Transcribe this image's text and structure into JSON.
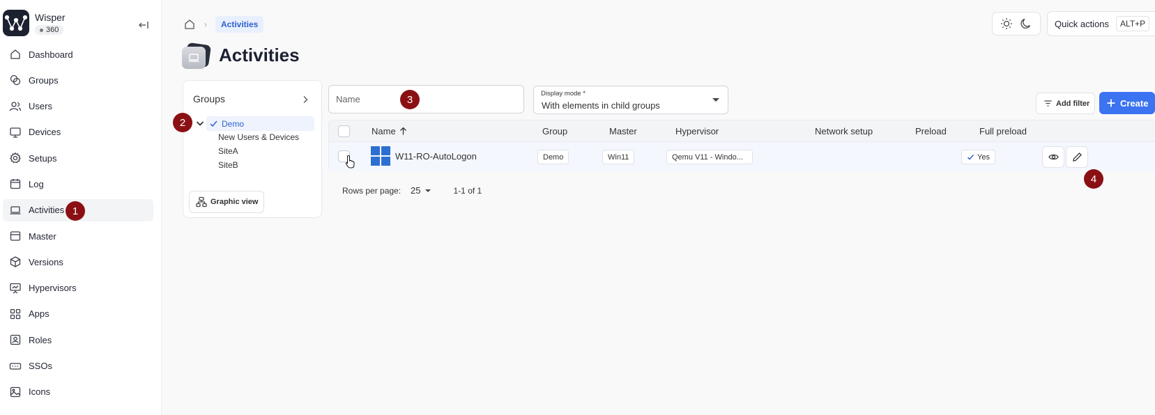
{
  "app": {
    "name": "Wisper",
    "badge": "360"
  },
  "sidebar": {
    "items": [
      {
        "label": "Dashboard",
        "icon": "home-icon"
      },
      {
        "label": "Groups",
        "icon": "groups-icon"
      },
      {
        "label": "Users",
        "icon": "users-icon"
      },
      {
        "label": "Devices",
        "icon": "monitor-icon"
      },
      {
        "label": "Setups",
        "icon": "gear-icon"
      },
      {
        "label": "Log",
        "icon": "calendar-icon"
      },
      {
        "label": "Activities",
        "icon": "laptop-icon",
        "active": true
      },
      {
        "label": "Master",
        "icon": "window-icon"
      },
      {
        "label": "Versions",
        "icon": "box-icon"
      },
      {
        "label": "Hypervisors",
        "icon": "presentation-icon"
      },
      {
        "label": "Apps",
        "icon": "grid-icon"
      },
      {
        "label": "Roles",
        "icon": "id-card-icon"
      },
      {
        "label": "SSOs",
        "icon": "key-icon"
      },
      {
        "label": "Icons",
        "icon": "image-icon"
      }
    ]
  },
  "header": {
    "breadcrumb_current": "Activities",
    "quick_actions_label": "Quick actions",
    "quick_actions_shortcut": "ALT+P",
    "page_title": "Activities"
  },
  "markers": [
    "1",
    "2",
    "3",
    "4"
  ],
  "groups_panel": {
    "title": "Groups",
    "selected": "Demo",
    "children": [
      "New Users & Devices",
      "SiteA",
      "SiteB"
    ],
    "graphic_view_label": "Graphic view"
  },
  "filters": {
    "name_placeholder": "Name",
    "display_mode_label": "Display mode *",
    "display_mode_value": "With elements in child groups",
    "add_filter_label": "Add filter",
    "create_label": "Create"
  },
  "table": {
    "columns": [
      "Name",
      "Group",
      "Master",
      "Hypervisor",
      "Network setup",
      "Preload",
      "Full preload"
    ],
    "rows": [
      {
        "name": "W11-RO-AutoLogon",
        "group": "Demo",
        "master": "Win11",
        "hypervisor": "Qemu V11 - Windo...",
        "network_setup": "",
        "preload": "",
        "full_preload": "Yes"
      }
    ]
  },
  "pagination": {
    "rows_per_page_label": "Rows per page:",
    "rows_per_page": "25",
    "range": "1-1 of 1"
  },
  "colors": {
    "accent": "#3b73f0",
    "marker": "#8b1014",
    "selected_bg": "#eef3fd"
  }
}
